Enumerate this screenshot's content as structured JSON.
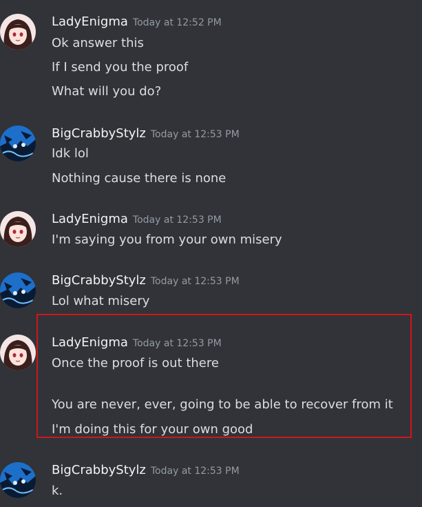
{
  "messages": [
    {
      "author": "LadyEnigma",
      "time": "Today at 12:52 PM",
      "lines": [
        "Ok answer this",
        "If I send you the proof",
        "What will you do?"
      ]
    },
    {
      "author": "BigCrabbyStylz",
      "time": "Today at 12:53 PM",
      "lines": [
        "Idk lol",
        "Nothing cause there is none"
      ]
    },
    {
      "author": "LadyEnigma",
      "time": "Today at 12:53 PM",
      "lines": [
        "I'm saying you from your own misery"
      ]
    },
    {
      "author": "BigCrabbyStylz",
      "time": "Today at 12:53 PM",
      "lines": [
        "Lol what misery"
      ]
    },
    {
      "author": "LadyEnigma",
      "time": "Today at 12:53 PM",
      "lines": [
        "Once the proof is out there",
        "You are never, ever, going to be able to recover from it",
        "I'm doing this for your own good"
      ]
    },
    {
      "author": "BigCrabbyStylz",
      "time": "Today at 12:53 PM",
      "lines": [
        "k."
      ]
    }
  ],
  "icons": {
    "lady_avatar": "girl-avatar-icon",
    "crabby_avatar": "blue-crab-avatar-icon"
  },
  "colors": {
    "background": "#313338",
    "username": "#f2f3f5",
    "message_text": "#dbdee1",
    "timestamp": "#949ba4",
    "highlight_box": "#d0161c"
  }
}
